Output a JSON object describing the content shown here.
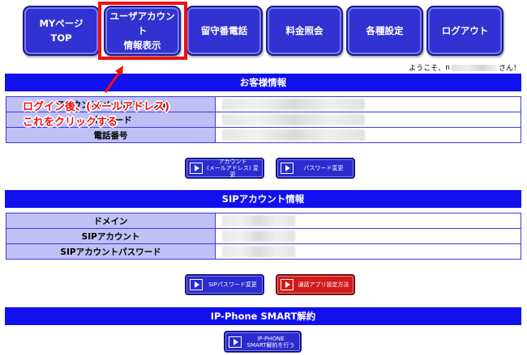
{
  "nav": {
    "mypage_line1": "MYページ",
    "mypage_line2": "TOP",
    "userinfo_line1": "ユーザアカウント",
    "userinfo_line2": "情報表示",
    "voicemail": "留守番電話",
    "billing": "料金照会",
    "settings": "各種設定",
    "logout": "ログアウト"
  },
  "welcome": {
    "prefix": "ようこそ、",
    "initial": "n",
    "suffix": "さん！"
  },
  "customer": {
    "title": "お客様情報",
    "row1_label": "アカウント(メールアドレス)",
    "row2_label": "パスワード",
    "row3_label": "電話番号"
  },
  "annotation": {
    "line1": "ログイン後、(メールアドレス)",
    "line2": "これをクリックする"
  },
  "buttons": {
    "account_change_line1": "アカウント",
    "account_change_line2": "(メールアドレス) 変更",
    "password_change": "パスワード変更",
    "sip_password_change": "SIPパスワード変更",
    "call_app_settings": "通話アプリ設定方法",
    "smart_cancel_line1": "IP-PHONE",
    "smart_cancel_line2": "SMART解約を行う"
  },
  "sip": {
    "title": "SIPアカウント情報",
    "row1_label": "ドメイン",
    "row2_label": "SIPアカウント",
    "row3_label": "SIPアカウントパスワード"
  },
  "smart": {
    "title": "IP-Phone SMART解約"
  },
  "colors": {
    "nav_blue": "#3232d2",
    "section_blue": "#1111ee",
    "label_bg": "#c0c0f6",
    "highlight_red": "#ee1111",
    "red_button": "#d11a1a"
  }
}
